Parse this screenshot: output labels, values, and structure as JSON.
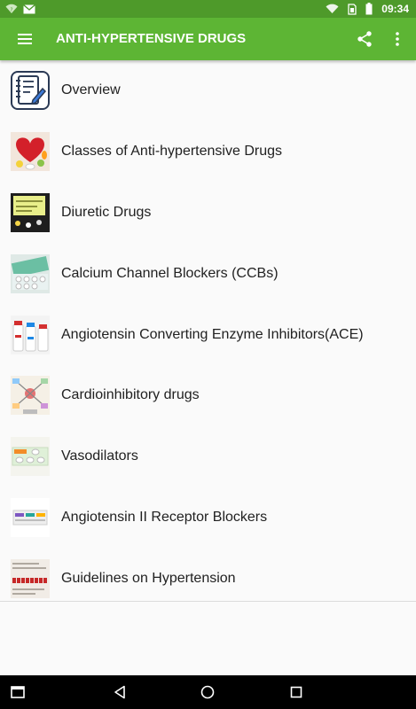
{
  "status_bar": {
    "time": "09:34",
    "icons": [
      "wifi-question-icon",
      "mail-icon",
      "wifi-icon",
      "sim-icon",
      "battery-icon"
    ]
  },
  "app_bar": {
    "title": "ANTI-HYPERTENSIVE DRUGS",
    "icons": [
      "menu-icon",
      "share-icon",
      "more-vert-icon"
    ]
  },
  "items": [
    {
      "label": "Overview",
      "icon": "notepad-icon"
    },
    {
      "label": "Classes of Anti-hypertensive Drugs",
      "icon": "pills-heart-image"
    },
    {
      "label": "Diuretic Drugs",
      "icon": "diuretic-image"
    },
    {
      "label": "Calcium Channel Blockers (CCBs)",
      "icon": "blister-pack-image"
    },
    {
      "label": "Angiotensin Converting Enzyme Inhibitors(ACE)",
      "icon": "bottles-image"
    },
    {
      "label": "Cardioinhibitory drugs",
      "icon": "diagram-image"
    },
    {
      "label": "Vasodilators",
      "icon": "tablet-strip-image"
    },
    {
      "label": "Angiotensin II Receptor Blockers",
      "icon": "medicine-box-image"
    },
    {
      "label": "Guidelines on Hypertension",
      "icon": "hypertension-text-image"
    }
  ],
  "nav_bar": {
    "icons": [
      "recent-apps-square-icon",
      "back-icon",
      "home-icon",
      "overview-icon"
    ]
  },
  "colors": {
    "status_bar": "#4e9a2a",
    "app_bar": "#5db534",
    "background": "#fafafa",
    "text": "#212121",
    "nav_bar": "#000000"
  }
}
